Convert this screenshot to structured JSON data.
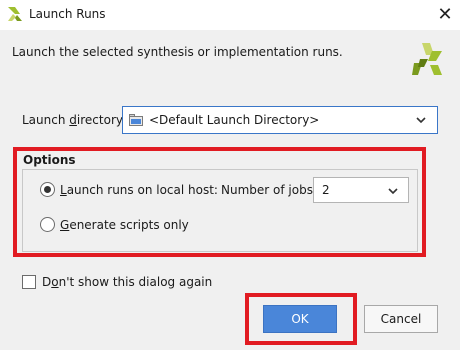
{
  "window": {
    "title": "Launch Runs",
    "close_glyph": "✕",
    "app_icon": "vivado-logo-icon"
  },
  "dialog": {
    "description": "Launch the selected synthesis or implementation runs."
  },
  "launch_directory": {
    "label_before": "Launch ",
    "label_underlined": "d",
    "label_after": "irectory:",
    "value": "<Default Launch Directory>"
  },
  "options": {
    "title": "Options",
    "local_host": {
      "label_underlined": "L",
      "label_rest": "aunch runs on local host:",
      "checked": true
    },
    "jobs": {
      "label": "Number of jobs:",
      "value": "2"
    },
    "scripts_only": {
      "label_underlined": "G",
      "label_rest": "enerate scripts only",
      "checked": false
    }
  },
  "dont_show": {
    "label_before": "D",
    "label_underlined": "o",
    "label_after": "n't show this dialog again",
    "checked": false
  },
  "buttons": {
    "ok": "OK",
    "cancel": "Cancel"
  },
  "colors": {
    "highlight_red": "#e11b22",
    "ok_blue": "#4a86d9",
    "logo_green": "#9fbf2f"
  }
}
